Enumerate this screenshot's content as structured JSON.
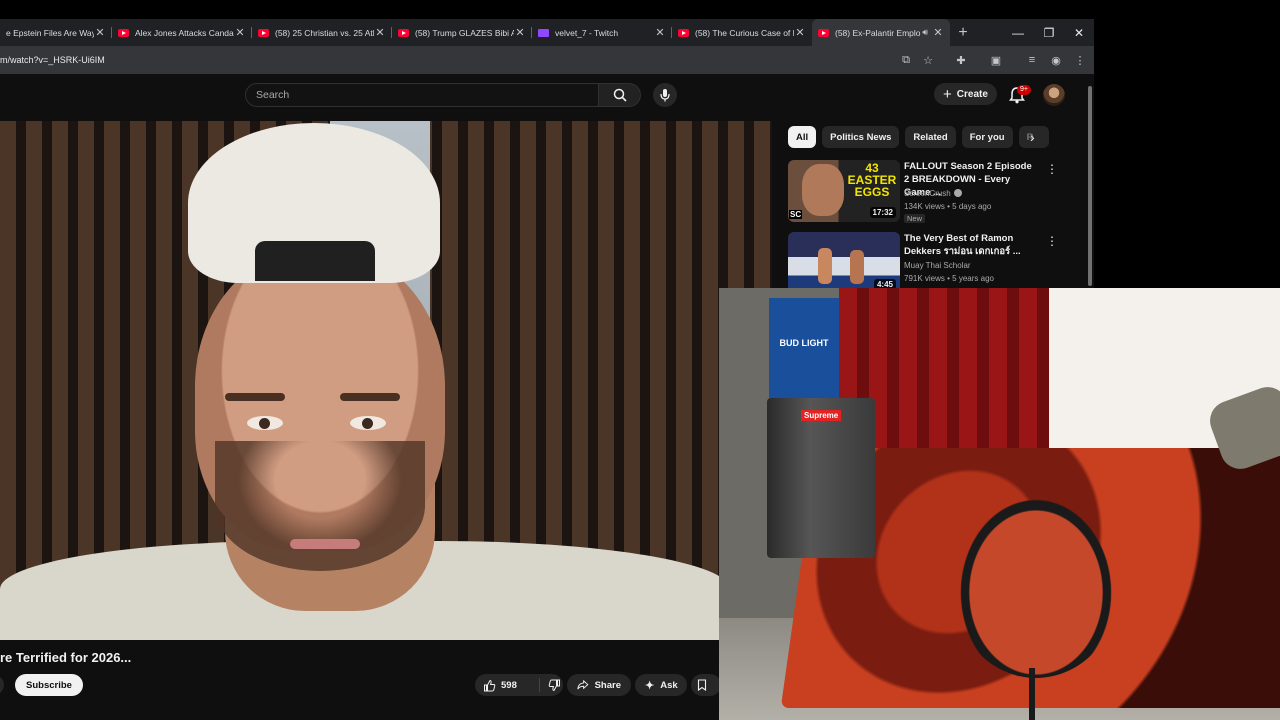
{
  "browser": {
    "tabs": [
      {
        "title": "e Epstein Files Are Way",
        "icon": "youtube-icon",
        "active": false
      },
      {
        "title": "Alex Jones Attacks Canda",
        "icon": "youtube-icon",
        "active": false
      },
      {
        "title": "(58) 25 Christian vs. 25 Ath",
        "icon": "youtube-icon",
        "active": false
      },
      {
        "title": "(58) Trump GLAZES Bibi A",
        "icon": "youtube-icon",
        "active": false
      },
      {
        "title": "velvet_7 - Twitch",
        "icon": "twitch-icon",
        "active": false
      },
      {
        "title": "(58) The Curious Case of E",
        "icon": "youtube-icon",
        "active": false
      },
      {
        "title": "(58) Ex-Palantir Emplo",
        "icon": "youtube-icon",
        "active": true
      }
    ],
    "new_tab": "+",
    "url": "m/watch?v=_HSRK-Ui6IM"
  },
  "youtube": {
    "search_placeholder": "Search",
    "create_label": "Create",
    "notification_count": "9+",
    "chips": [
      "All",
      "Politics News",
      "Related",
      "For you",
      "R"
    ],
    "recommendations": [
      {
        "title": "FALLOUT Season 2 Episode 2 BREAKDOWN - Every Game ...",
        "channel": "ScreenCrush",
        "meta": "134K views • 5 days ago",
        "badge": "New",
        "duration": "17:32",
        "thumb_text": "43 EASTER EGGS",
        "thumb_corner": "SC"
      },
      {
        "title": "The Very Best of Ramon Dekkers ราม่อน เดกเกอร์ ...",
        "channel": "Muay Thai Scholar",
        "meta": "791K views • 5 years ago",
        "duration": "4:45"
      }
    ],
    "video_title": "re Terrified for 2026...",
    "subscribe_label": "Subscribe",
    "like_count": "598",
    "share_label": "Share",
    "ask_label": "Ask"
  },
  "webcam": {
    "box_text": "BUD LIGHT",
    "sticker_text": "Supreme"
  }
}
